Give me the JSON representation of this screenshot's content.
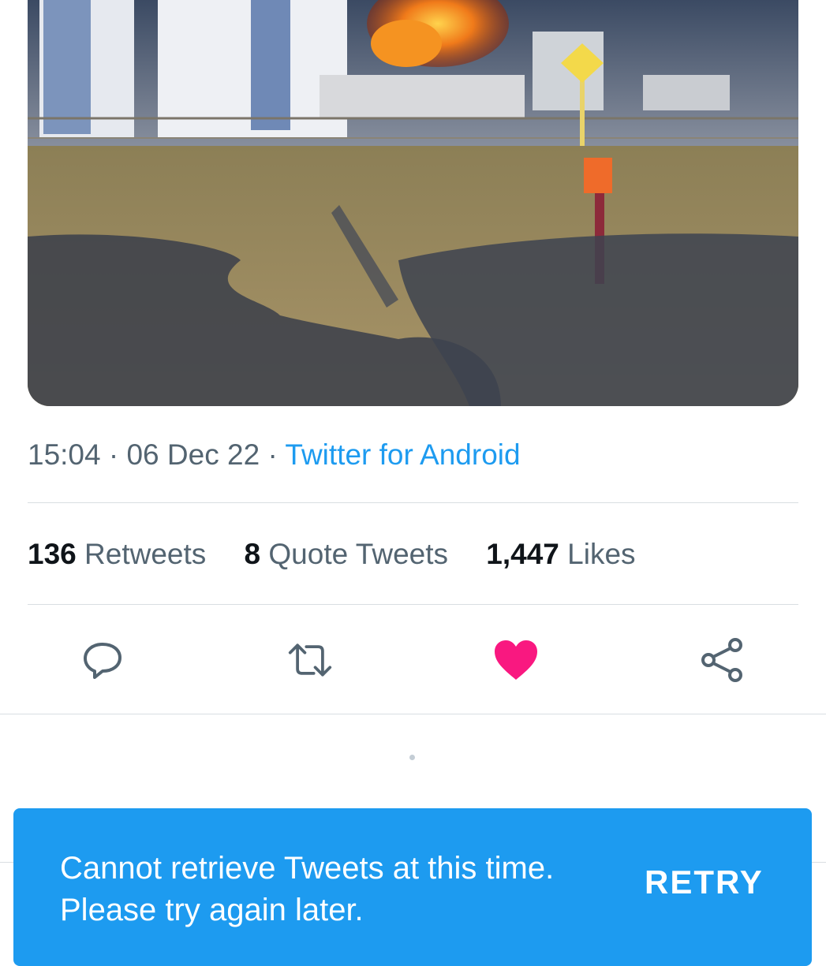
{
  "tweet": {
    "time": "15:04",
    "separator": "·",
    "date": "06 Dec 22",
    "source": "Twitter for Android",
    "media_icon": "video-frame-fire-scene"
  },
  "stats": {
    "retweets_count": "136",
    "retweets_label": "Retweets",
    "quotes_count": "8",
    "quotes_label": "Quote Tweets",
    "likes_count": "1,447",
    "likes_label": "Likes"
  },
  "actions": {
    "reply_icon": "reply-icon",
    "retweet_icon": "retweet-icon",
    "like_icon": "heart-icon",
    "share_icon": "share-icon",
    "liked": true
  },
  "snackbar": {
    "message": "Cannot retrieve Tweets at this time. Please try again later.",
    "action_label": "RETRY"
  },
  "colors": {
    "accent": "#1d9bf0",
    "like": "#f91880",
    "secondary_text": "#536471",
    "primary_text": "#0f1419"
  }
}
